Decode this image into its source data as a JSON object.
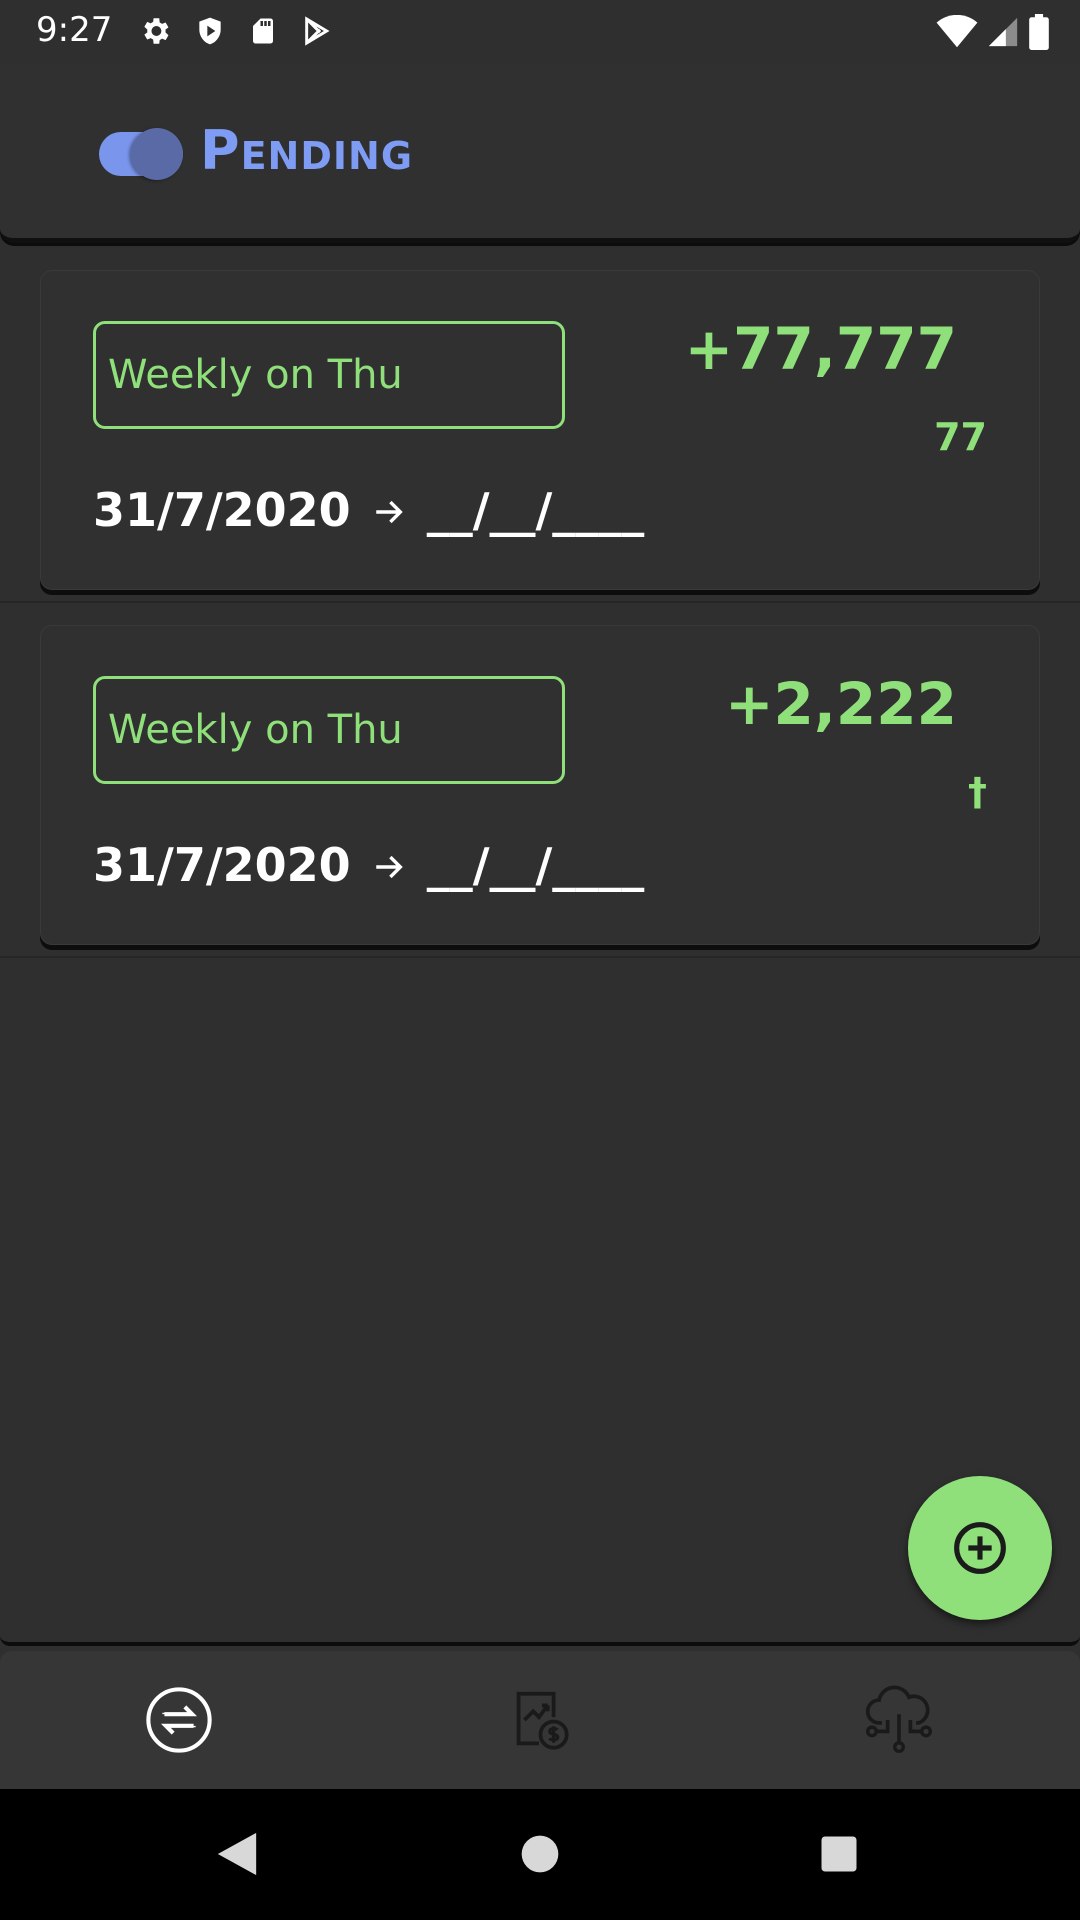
{
  "status_bar": {
    "time": "9:27",
    "icons_left": [
      "settings-icon",
      "shield-icon",
      "sd-card-icon",
      "play-store-icon"
    ],
    "icons_right": [
      "wifi-icon",
      "cell-signal-icon",
      "battery-icon"
    ]
  },
  "header": {
    "title": "Pending",
    "toggle_on": true
  },
  "colors": {
    "background": "#2f2f2f",
    "accent_green": "#8fe07a",
    "accent_blue": "#7f9cf5",
    "text_primary": "#ffffff"
  },
  "transactions": [
    {
      "frequency": "Weekly on Thu",
      "amount": "+77,777",
      "amount_sub": "77",
      "start_date": "31/7/2020",
      "end_date": "__/__/____"
    },
    {
      "frequency": "Weekly on Thu",
      "amount": "+2,222",
      "amount_sub": "†",
      "start_date": "31/7/2020",
      "end_date": "__/__/____"
    }
  ],
  "fab": {
    "icon": "add-circle-icon"
  },
  "bottom_nav": {
    "items": [
      {
        "icon": "swap-arrows-icon",
        "active": true
      },
      {
        "icon": "finance-chart-icon",
        "active": false
      },
      {
        "icon": "cloud-network-icon",
        "active": false
      }
    ]
  },
  "system_nav": [
    "back-icon",
    "home-icon",
    "recents-icon"
  ]
}
